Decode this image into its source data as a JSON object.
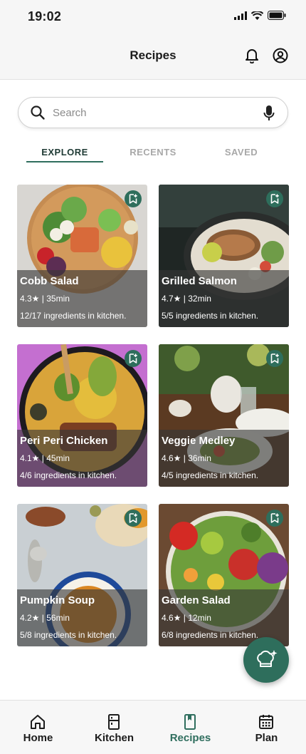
{
  "status_bar": {
    "time": "19:02"
  },
  "header": {
    "title": "Recipes"
  },
  "search": {
    "placeholder": "Search"
  },
  "tabs": [
    {
      "label": "EXPLORE",
      "active": true
    },
    {
      "label": "RECENTS",
      "active": false
    },
    {
      "label": "SAVED",
      "active": false
    }
  ],
  "recipes": [
    {
      "title": "Cobb Salad",
      "meta": "4.3★ | 35min",
      "ingredients": "12/17 ingredients in kitchen."
    },
    {
      "title": "Grilled Salmon",
      "meta": "4.7★ | 32min",
      "ingredients": "5/5 ingredients in kitchen."
    },
    {
      "title": "Peri Peri Chicken",
      "meta": "4.1★ | 45min",
      "ingredients": "4/6 ingredients in kitchen."
    },
    {
      "title": "Veggie Medley",
      "meta": "4.6★ | 36min",
      "ingredients": "4/5 ingredients in kitchen."
    },
    {
      "title": "Pumpkin Soup",
      "meta": "4.2★ | 56min",
      "ingredients": "5/8 ingredients in kitchen."
    },
    {
      "title": "Garden Salad",
      "meta": "4.6★ | 12min",
      "ingredients": "6/8 ingredients in kitchen."
    }
  ],
  "bottom_nav": [
    {
      "label": "Home",
      "icon": "home-icon",
      "active": false
    },
    {
      "label": "Kitchen",
      "icon": "fridge-icon",
      "active": false
    },
    {
      "label": "Recipes",
      "icon": "book-icon",
      "active": true
    },
    {
      "label": "Plan",
      "icon": "calendar-icon",
      "active": false
    }
  ],
  "colors": {
    "accent": "#2e6e5c",
    "tab_inactive": "#a8a8a8",
    "nav_active": "#2f6e5e"
  }
}
